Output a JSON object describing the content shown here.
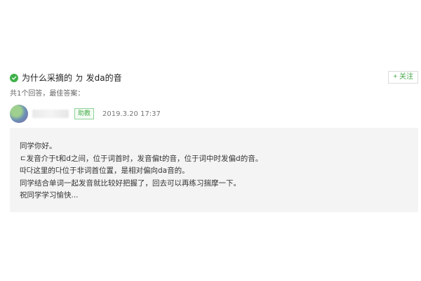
{
  "question": {
    "title": "为什么采摘的 ㄉ 发da的音",
    "follow_label": "+ 关注"
  },
  "meta": {
    "answer_count_text": "共1个回答，最佳答案："
  },
  "answerer": {
    "role_badge": "助教",
    "timestamp": "2019.3.20 17:37"
  },
  "answer": {
    "lines": [
      "同学你好。",
      "ㄷ发音介于t和d之间，位于词首时，发音偏t的音，位于词中时发偏d的音。",
      "따다这里的다位于非词首位置，是相对偏向da音的。",
      "同学结合单词一起发音就比较好把握了，回去可以再练习揣摩一下。",
      "祝同学学习愉快..."
    ]
  },
  "colors": {
    "accent_green": "#3fb14a",
    "answer_bg": "#f4f4f4"
  }
}
